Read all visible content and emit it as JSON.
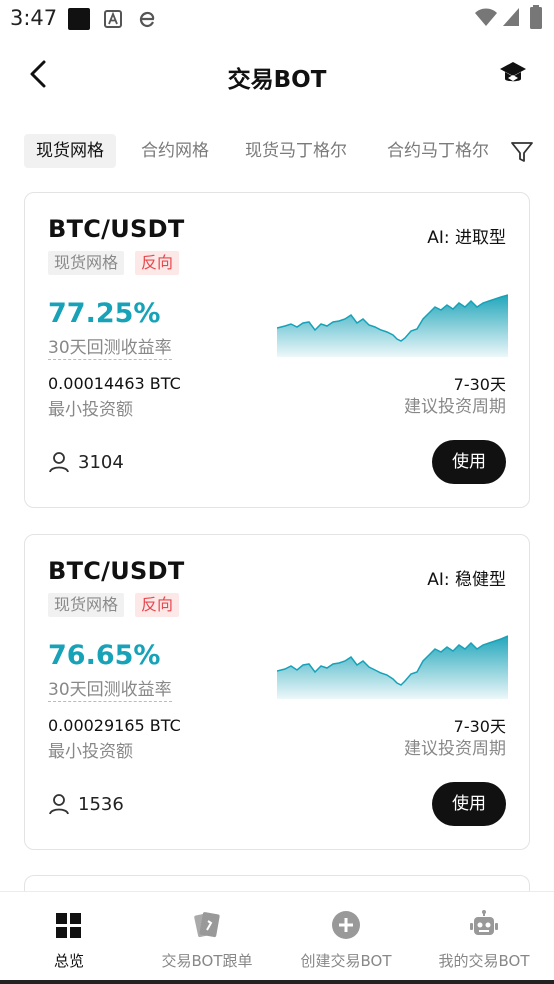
{
  "status_bar": {
    "time": "3:47"
  },
  "header": {
    "title": "交易BOT"
  },
  "tabs": [
    {
      "label": "现货网格",
      "active": true
    },
    {
      "label": "合约网格",
      "active": false
    },
    {
      "label": "现货马丁格尔",
      "active": false
    },
    {
      "label": "合约马丁格尔",
      "active": false
    }
  ],
  "cards": [
    {
      "pair": "BTC/USDT",
      "type_tag": "现货网格",
      "direction_tag": "反向",
      "ai_label": "AI: 进取型",
      "yield": "77.25%",
      "yield_label": "30天回测收益率",
      "min_investment": "0.00014463 BTC",
      "min_investment_label": "最小投资额",
      "period": "7-30天",
      "period_label": "建议投资周期",
      "users": "3104",
      "use_label": "使用"
    },
    {
      "pair": "BTC/USDT",
      "type_tag": "现货网格",
      "direction_tag": "反向",
      "ai_label": "AI: 稳健型",
      "yield": "76.65%",
      "yield_label": "30天回测收益率",
      "min_investment": "0.00029165 BTC",
      "min_investment_label": "最小投资额",
      "period": "7-30天",
      "period_label": "建议投资周期",
      "users": "1536",
      "use_label": "使用"
    }
  ],
  "bottom_nav": [
    {
      "label": "总览",
      "icon": "grid-icon",
      "active": true
    },
    {
      "label": "交易BOT跟单",
      "icon": "cards-icon",
      "active": false
    },
    {
      "label": "创建交易BOT",
      "icon": "plus-circle-icon",
      "active": false
    },
    {
      "label": "我的交易BOT",
      "icon": "robot-icon",
      "active": false
    }
  ],
  "colors": {
    "accent": "#17a2b8",
    "negative": "#e5484d",
    "button": "#111111"
  }
}
